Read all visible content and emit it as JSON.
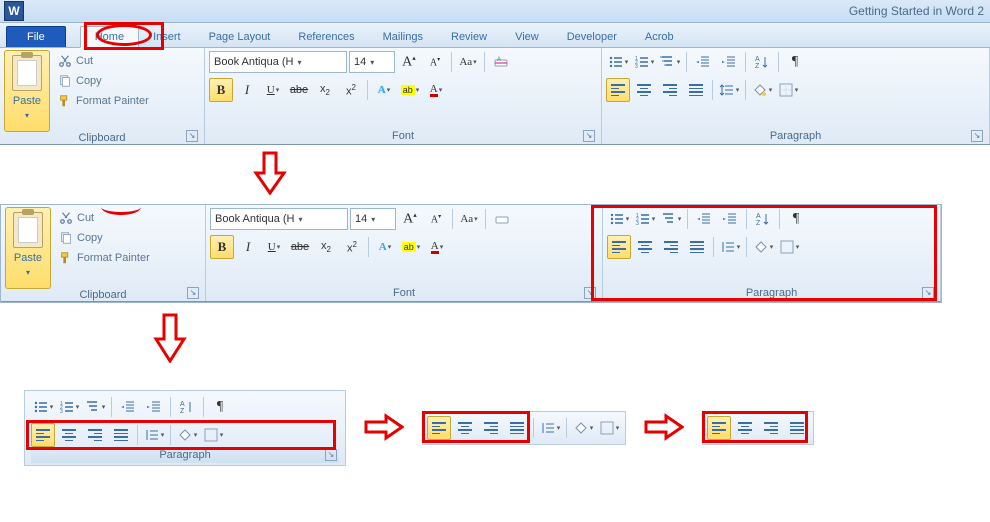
{
  "title": "Getting Started in Word 2",
  "tabs": {
    "file": "File",
    "home": "Home",
    "insert": "Insert",
    "page_layout": "Page Layout",
    "references": "References",
    "mailings": "Mailings",
    "review": "Review",
    "view": "View",
    "developer": "Developer",
    "acrobat": "Acrob"
  },
  "clipboard": {
    "paste": "Paste",
    "cut": "Cut",
    "copy": "Copy",
    "format_painter": "Format Painter",
    "label": "Clipboard"
  },
  "font": {
    "name": "Book Antiqua (H",
    "size": "14",
    "label": "Font"
  },
  "paragraph": {
    "label": "Paragraph"
  }
}
